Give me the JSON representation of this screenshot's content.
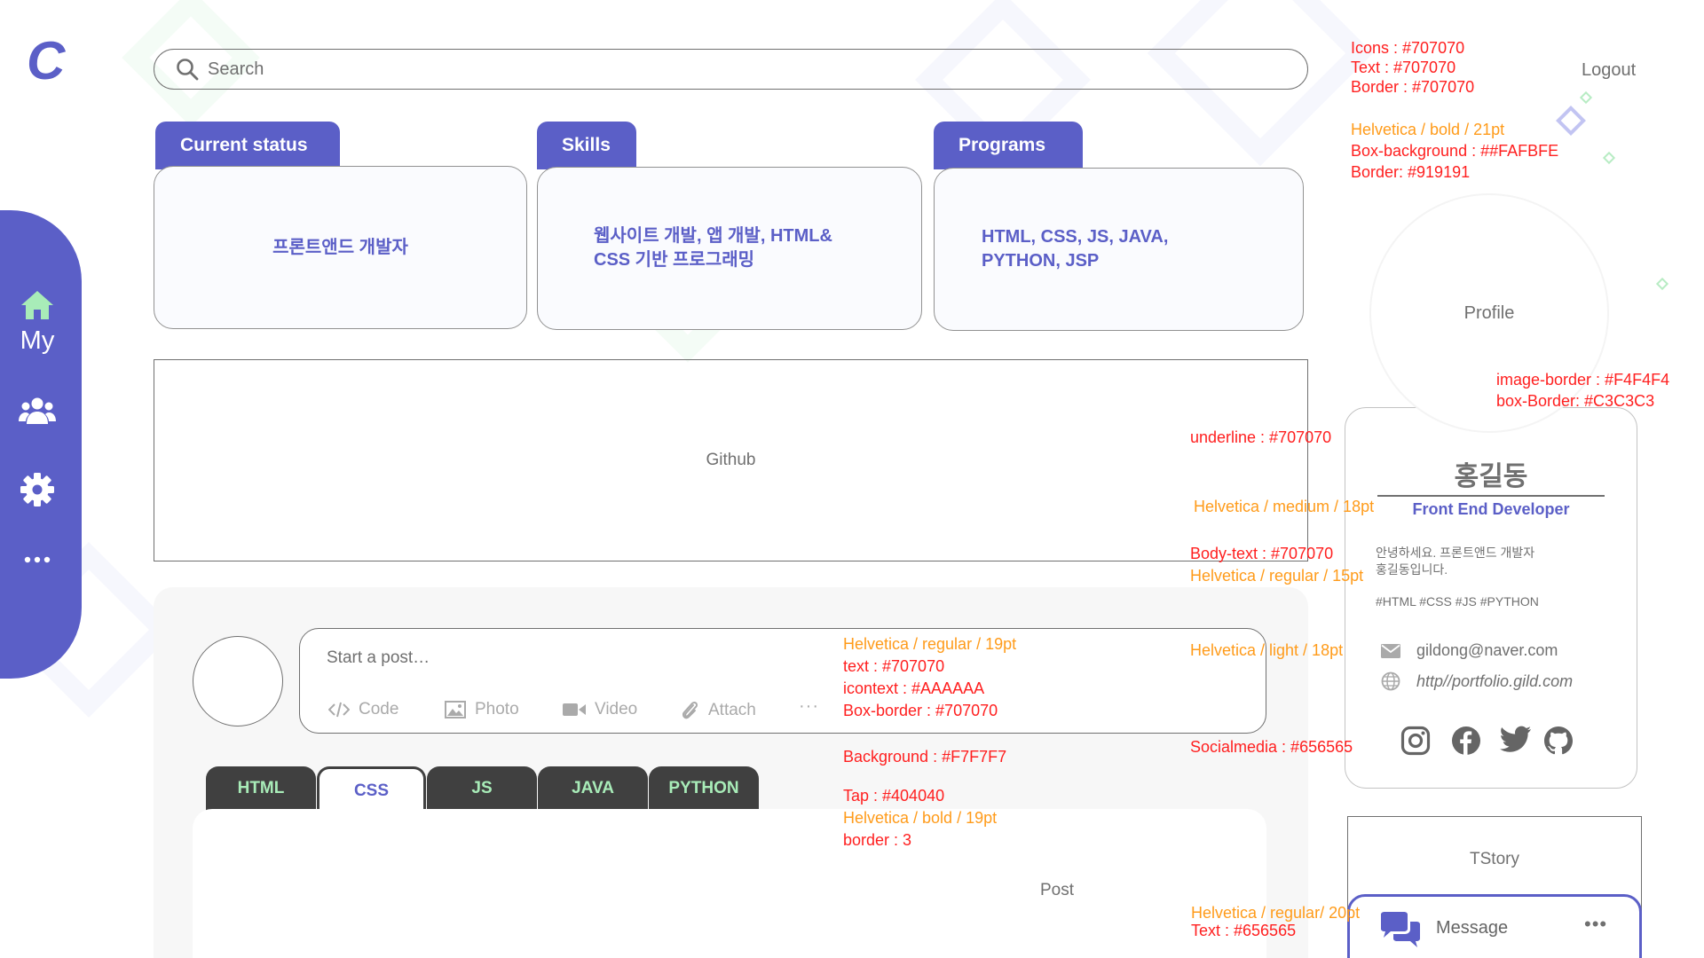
{
  "logo": "C",
  "search": {
    "placeholder": "Search"
  },
  "logout": "Logout",
  "sidebar": {
    "items": [
      {
        "icon": "home-icon"
      },
      {
        "label": "My"
      },
      {
        "icon": "users-icon"
      },
      {
        "icon": "gear-icon"
      },
      {
        "icon": "more-icon"
      }
    ]
  },
  "cards": [
    {
      "tab": "Current status",
      "body": "프론트앤드 개발자"
    },
    {
      "tab": "Skills",
      "body_lines": [
        "웹사이트 개발, 앱 개발, HTML&",
        "CSS 기반 프로그래밍"
      ]
    },
    {
      "tab": "Programs",
      "body_lines": [
        "HTML, CSS, JS, JAVA,",
        "PYTHON, JSP"
      ]
    }
  ],
  "github": "Github",
  "composer": {
    "placeholder": "Start a post…",
    "tools": [
      "Code",
      "Photo",
      "Video",
      "Attach"
    ],
    "more": "···"
  },
  "tabs": [
    "HTML",
    "CSS",
    "JS",
    "JAVA",
    "PYTHON"
  ],
  "active_tab": "CSS",
  "post": "Post",
  "profile": {
    "image_label": "Profile",
    "name": "홍길동",
    "role": "Front End Developer",
    "bio_lines": [
      "안녕하세요. 프론트앤드 개발자",
      "홍길동입니다."
    ],
    "tags": "#HTML #CSS #JS #PYTHON",
    "email": "gildong@naver.com",
    "site": "http//portfolio.gild.com",
    "social": [
      "instagram-icon",
      "facebook-icon",
      "twitter-icon",
      "github-icon"
    ]
  },
  "tstory": "TStory",
  "message": {
    "label": "Message",
    "more": "•••"
  },
  "annotations": {
    "top_right": {
      "lines_red": [
        "Icons : #707070",
        "Text : #707070",
        "Border : #707070"
      ],
      "line_orange": "Helvetica / bold / 21pt",
      "lines_red2": [
        "Box-background : ##FAFBFE",
        "Border: #919191"
      ]
    },
    "image_border": [
      "image-border : #F4F4F4",
      "box-Border: #C3C3C3"
    ],
    "underline": "underline : #707070",
    "medium": "Helvetica / medium / 18pt",
    "body_text": "Body-text : #707070",
    "regular15": "Helvetica / regular / 15pt",
    "light18": "Helvetica / light / 18pt",
    "social": "Socialmedia : #656565",
    "composer": {
      "orange": "Helvetica / regular / 19pt",
      "red": [
        "text : #707070",
        "icontext : #AAAAAA",
        "Box-border : #707070"
      ]
    },
    "background": "Background : #F7F7F7",
    "tap": {
      "red1": "Tap : #404040",
      "orange": "Helvetica / bold / 19pt",
      "red2": "border : 3"
    },
    "message": {
      "orange": "Helvetica / regular/ 20pt",
      "red": "Text : #656565"
    }
  },
  "colors": {
    "accent": "#5b5fc7",
    "tab": "#404040",
    "tab_text": "#a8ecb8",
    "feed_bg": "#f7f7f7"
  }
}
